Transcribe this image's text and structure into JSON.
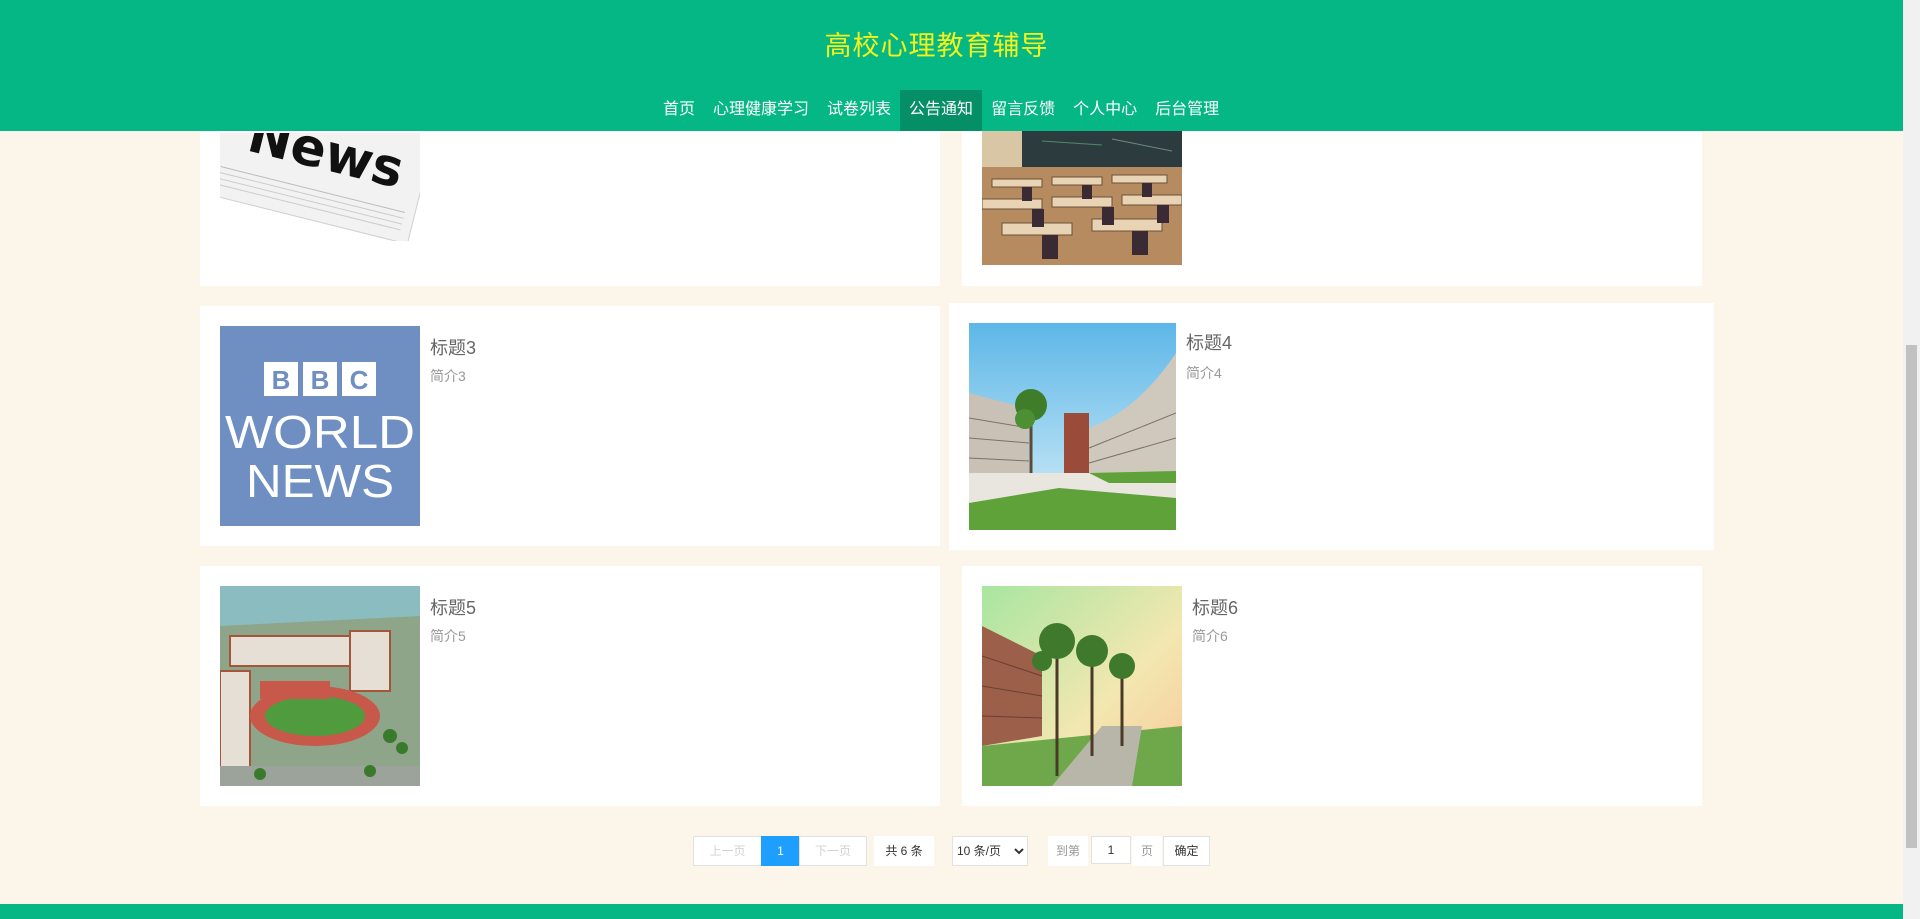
{
  "header": {
    "title": "高校心理教育辅导"
  },
  "nav": {
    "items": [
      {
        "label": "首页"
      },
      {
        "label": "心理健康学习"
      },
      {
        "label": "试卷列表"
      },
      {
        "label": "公告通知",
        "active": true
      },
      {
        "label": "留言反馈"
      },
      {
        "label": "个人中心"
      },
      {
        "label": "后台管理"
      }
    ]
  },
  "cards": [
    {
      "title": "",
      "summary": "",
      "image": "news-newspaper-image"
    },
    {
      "title": "",
      "summary": "",
      "image": "classroom-image"
    },
    {
      "title": "标题3",
      "summary": "简介3",
      "image": "bbc-world-news-image",
      "image_text": [
        "BBC",
        "WORLD",
        "NEWS"
      ]
    },
    {
      "title": "标题4",
      "summary": "简介4",
      "image": "campus-courtyard-image"
    },
    {
      "title": "标题5",
      "summary": "简介5",
      "image": "campus-aerial-image"
    },
    {
      "title": "标题6",
      "summary": "简介6",
      "image": "tree-lined-path-image"
    }
  ],
  "news_image_text": "News",
  "pagination": {
    "prev": "上一页",
    "current": "1",
    "next": "下一页",
    "total": "共 6 条",
    "page_size": "10 条/页",
    "goto_prefix": "到第",
    "goto_value": "1",
    "goto_suffix": "页",
    "confirm": "确定"
  },
  "colors": {
    "primary": "#05b785",
    "title": "#f4f21a",
    "nav_active": "#058f67",
    "page_bg": "#fbf5ea",
    "pager_active": "#1e9fff"
  }
}
